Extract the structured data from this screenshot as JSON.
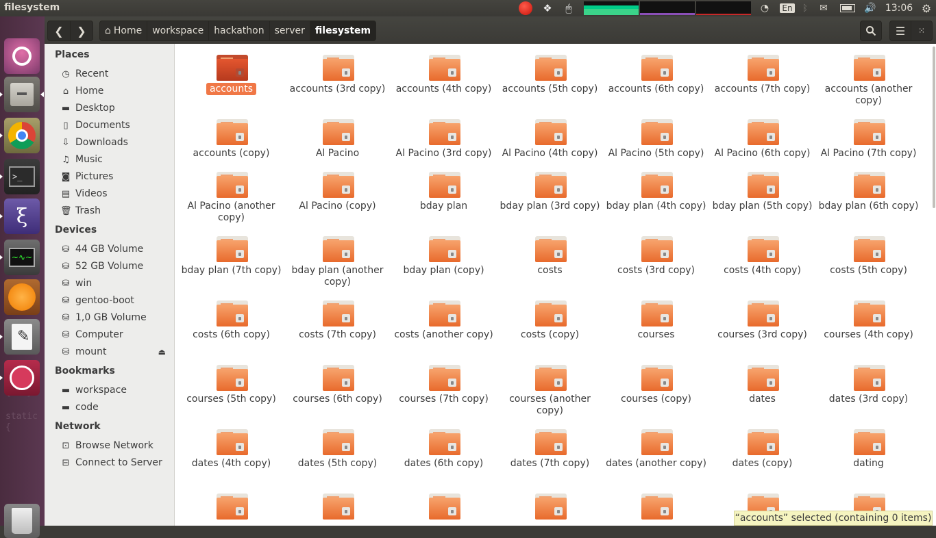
{
  "window": {
    "title": "filesystem"
  },
  "panel": {
    "keyboard_layout": "En",
    "clock": "13:06"
  },
  "toolbar": {
    "breadcrumbs": [
      "Home",
      "workspace",
      "hackathon",
      "server",
      "filesystem"
    ]
  },
  "sidebar": {
    "places_heading": "Places",
    "places": [
      {
        "label": "Recent",
        "icon": "clock-icon"
      },
      {
        "label": "Home",
        "icon": "home-icon"
      },
      {
        "label": "Desktop",
        "icon": "folder-icon"
      },
      {
        "label": "Documents",
        "icon": "document-icon"
      },
      {
        "label": "Downloads",
        "icon": "download-icon"
      },
      {
        "label": "Music",
        "icon": "music-icon"
      },
      {
        "label": "Pictures",
        "icon": "camera-icon"
      },
      {
        "label": "Videos",
        "icon": "film-icon"
      },
      {
        "label": "Trash",
        "icon": "trash-icon"
      }
    ],
    "devices_heading": "Devices",
    "devices": [
      "44 GB Volume",
      "52 GB Volume",
      "win",
      "gentoo-boot",
      "1,0 GB Volume",
      "Computer",
      "mount"
    ],
    "bookmarks_heading": "Bookmarks",
    "bookmarks": [
      "workspace",
      "code"
    ],
    "network_heading": "Network",
    "network": [
      "Browse Network",
      "Connect to Server"
    ]
  },
  "launcher": {
    "background_text": [
      "static",
      "{...}",
      "static",
      "{"
    ]
  },
  "files": [
    "accounts",
    "accounts (3rd copy)",
    "accounts (4th copy)",
    "accounts (5th copy)",
    "accounts (6th copy)",
    "accounts (7th copy)",
    "accounts (another copy)",
    "accounts (copy)",
    "Al Pacino",
    "Al Pacino (3rd copy)",
    "Al Pacino (4th copy)",
    "Al Pacino (5th copy)",
    "Al Pacino (6th copy)",
    "Al Pacino (7th copy)",
    "Al Pacino (another copy)",
    "Al Pacino (copy)",
    "bday plan",
    "bday plan (3rd copy)",
    "bday plan (4th copy)",
    "bday plan (5th copy)",
    "bday plan (6th copy)",
    "bday plan (7th copy)",
    "bday plan (another copy)",
    "bday plan (copy)",
    "costs",
    "costs (3rd copy)",
    "costs (4th copy)",
    "costs (5th copy)",
    "costs (6th copy)",
    "costs (7th copy)",
    "costs (another copy)",
    "costs (copy)",
    "courses",
    "courses (3rd copy)",
    "courses (4th copy)",
    "courses (5th copy)",
    "courses (6th copy)",
    "courses (7th copy)",
    "courses (another copy)",
    "courses (copy)",
    "dates",
    "dates (3rd copy)",
    "dates (4th copy)",
    "dates (5th copy)",
    "dates (6th copy)",
    "dates (7th copy)",
    "dates (another copy)",
    "dates (copy)",
    "dating",
    "",
    "",
    "",
    "",
    "",
    "",
    ""
  ],
  "selected_file": "accounts",
  "status": {
    "text": "“accounts” selected (containing 0 items)"
  },
  "colors": {
    "accent": "#f07746",
    "folder": "#e86a2c",
    "launcher": "#5b3851"
  }
}
